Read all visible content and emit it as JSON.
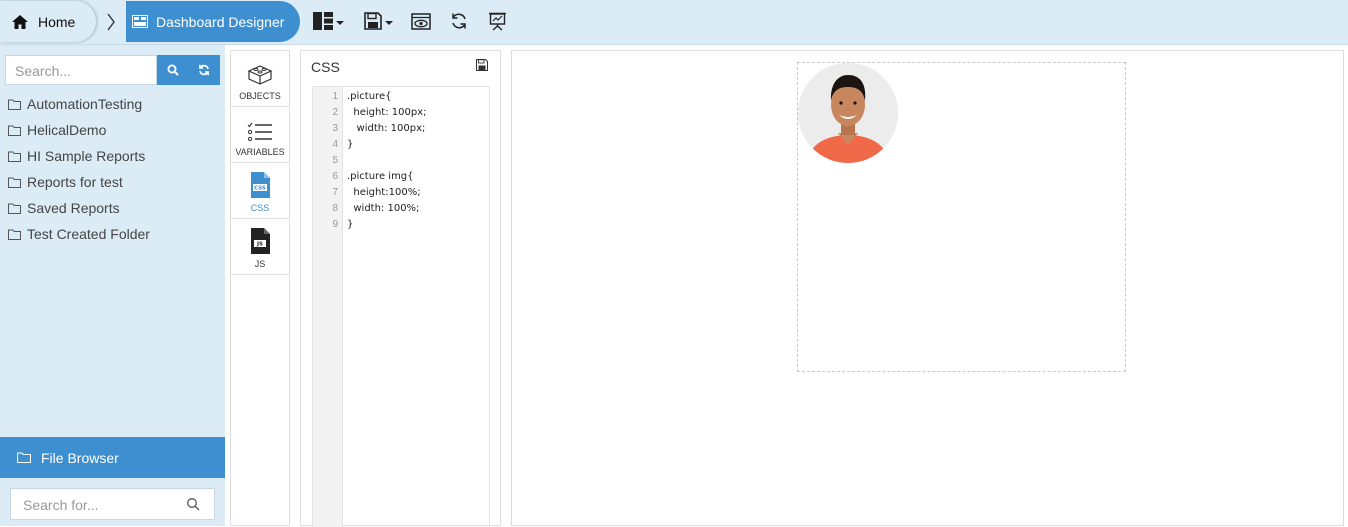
{
  "breadcrumb": {
    "home_label": "Home",
    "current_label": "Dashboard Designer"
  },
  "toolbar": {
    "icons": [
      "layout-icon",
      "save-icon",
      "preview-icon",
      "refresh-icon",
      "presentation-icon"
    ]
  },
  "sidebar": {
    "search_placeholder": "Search...",
    "folders": [
      {
        "label": "AutomationTesting"
      },
      {
        "label": "HelicalDemo"
      },
      {
        "label": "HI Sample Reports"
      },
      {
        "label": "Reports for test"
      },
      {
        "label": "Saved Reports"
      },
      {
        "label": "Test Created Folder"
      }
    ],
    "file_browser_label": "File Browser",
    "file_search_placeholder": "Search for..."
  },
  "palette": {
    "items": [
      {
        "label": "OBJECTS"
      },
      {
        "label": "VARIABLES"
      },
      {
        "label": "CSS"
      },
      {
        "label": "JS"
      }
    ],
    "active": "CSS"
  },
  "css_panel": {
    "title": "CSS",
    "lines": [
      {
        "no": "1",
        "code": ".picture{"
      },
      {
        "no": "2",
        "code": "  height: 100px;"
      },
      {
        "no": "3",
        "code": "   width: 100px;"
      },
      {
        "no": "4",
        "code": "}"
      },
      {
        "no": "5",
        "code": ""
      },
      {
        "no": "6",
        "code": ".picture img{"
      },
      {
        "no": "7",
        "code": "  height:100%;"
      },
      {
        "no": "8",
        "code": "  width: 100%;"
      },
      {
        "no": "9",
        "code": "}"
      }
    ]
  },
  "colors": {
    "accent": "#3d8fd0",
    "topbar_bg": "#dcecf7",
    "sidebar_bg": "#dcecf7"
  }
}
